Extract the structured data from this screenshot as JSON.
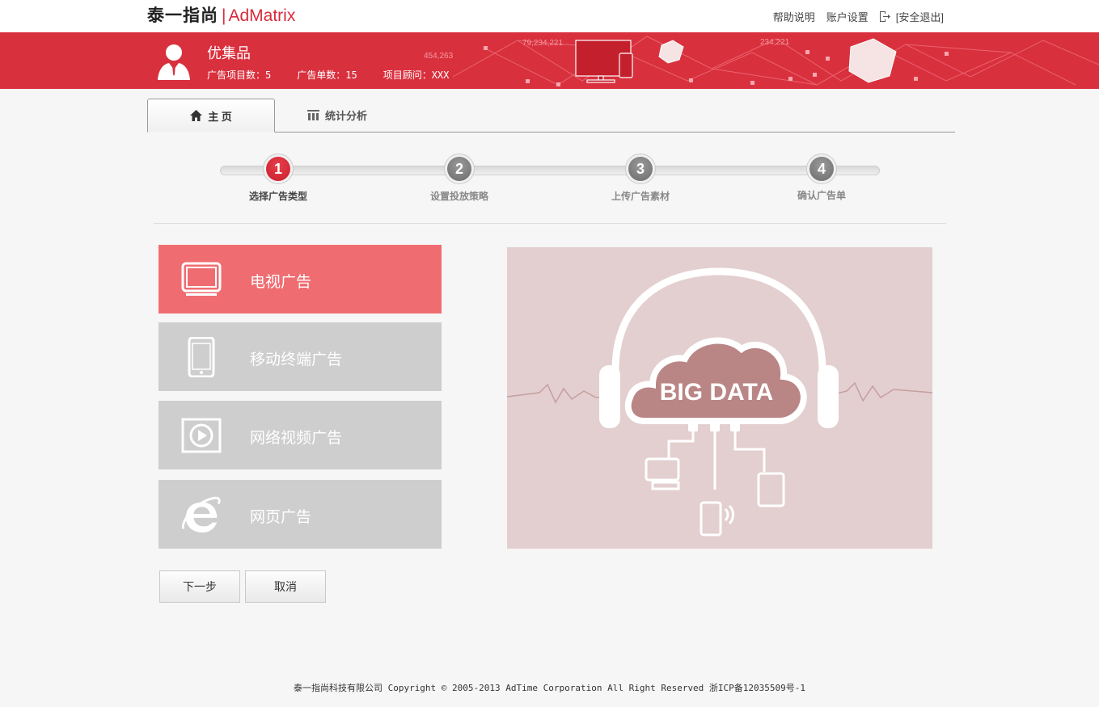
{
  "brand": {
    "name_cn": "泰一指尚",
    "separator": "|",
    "name_en": "AdMatrix"
  },
  "top_links": {
    "help": "帮助说明",
    "account": "账户设置",
    "logout": "[安全退出]"
  },
  "banner": {
    "company": "优集品",
    "stats": [
      "广告项目数：5",
      "广告单数：15",
      "项目顾问：XXX"
    ],
    "deco_numbers": [
      "79,234,221",
      "454,263",
      "234,221"
    ]
  },
  "tabs": [
    {
      "label": "主 页",
      "icon": "home-icon",
      "active": true
    },
    {
      "label": "统计分析",
      "icon": "chart-icon",
      "active": false
    }
  ],
  "steps": [
    {
      "num": "1",
      "label": "选择广告类型",
      "current": true
    },
    {
      "num": "2",
      "label": "设置投放策略",
      "current": false
    },
    {
      "num": "3",
      "label": "上传广告素材",
      "current": false
    },
    {
      "num": "4",
      "label": "确认广告单",
      "current": false
    }
  ],
  "ad_types": [
    {
      "label": "电视广告",
      "icon": "tv-icon",
      "selected": true
    },
    {
      "label": "移动终端广告",
      "icon": "mobile-icon",
      "selected": false
    },
    {
      "label": "网络视频广告",
      "icon": "video-play-icon",
      "selected": false
    },
    {
      "label": "网页广告",
      "icon": "ie-browser-icon",
      "selected": false
    }
  ],
  "visual": {
    "text": "BIG DATA"
  },
  "buttons": {
    "next": "下一步",
    "cancel": "取消"
  },
  "footer": "泰一指尚科技有限公司 Copyright © 2005-2013 AdTime Corporation All Right Reserved 浙ICP备12035509号-1",
  "colors": {
    "brand_red": "#d9303e",
    "selected_red": "#ef6d71",
    "inactive_gray": "#cecece"
  }
}
